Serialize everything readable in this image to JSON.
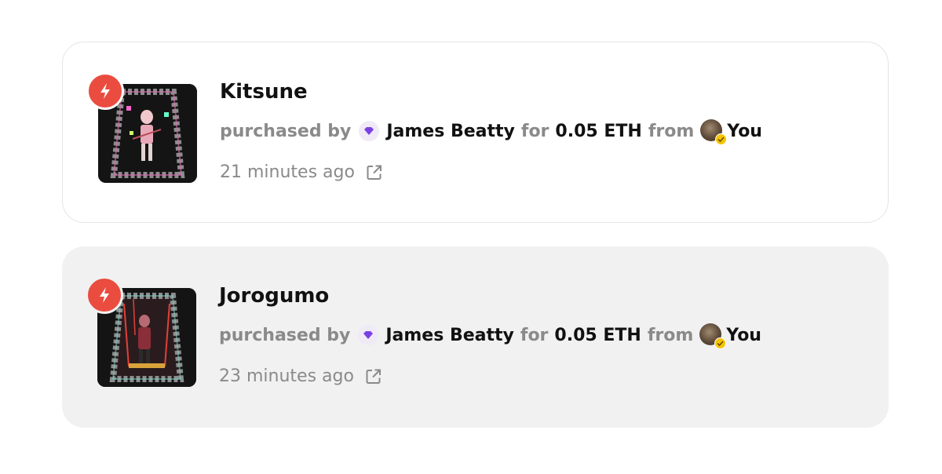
{
  "activity": [
    {
      "title": "Kitsune",
      "action_label": "purchased by",
      "buyer": "James Beatty",
      "for_label": "for",
      "price": "0.05 ETH",
      "from_label": "from",
      "seller": "You",
      "time": "21 minutes ago",
      "icons": {
        "badge": "lightning-icon",
        "link": "external-link-icon",
        "buyer_avatar": "gem-avatar",
        "seller_avatar": "user-avatar",
        "verified": "check-icon"
      }
    },
    {
      "title": "Jorogumo",
      "action_label": "purchased by",
      "buyer": "James Beatty",
      "for_label": "for",
      "price": "0.05 ETH",
      "from_label": "from",
      "seller": "You",
      "time": "23 minutes ago",
      "icons": {
        "badge": "lightning-icon",
        "link": "external-link-icon",
        "buyer_avatar": "gem-avatar",
        "seller_avatar": "user-avatar",
        "verified": "check-icon"
      }
    }
  ],
  "colors": {
    "badge": "#ea4d3f",
    "muted_text": "#8a8a8a",
    "strong_text": "#111111",
    "filled_card": "#f1f1f1",
    "verified": "#f5c400",
    "gem": "#7b3fe4"
  }
}
